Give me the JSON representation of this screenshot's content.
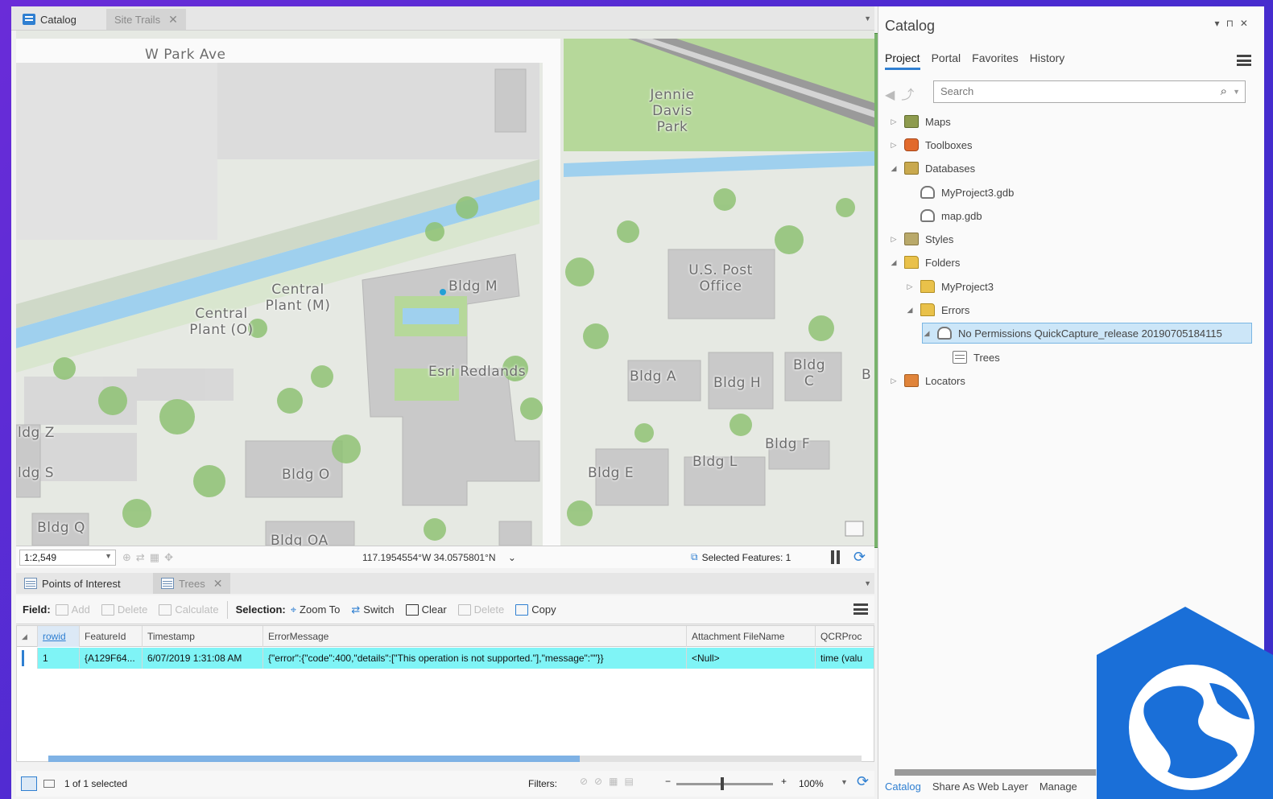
{
  "map_tabs": [
    {
      "label": "Catalog",
      "icon": "catalog-icon",
      "active": true
    },
    {
      "label": "Site Trails",
      "icon": "map-icon",
      "active": false
    }
  ],
  "map": {
    "labels": {
      "street": "W Park Ave",
      "park": "Jennie Davis Park",
      "post_office": "U.S. Post Office",
      "central_m": "Central Plant (M)",
      "central_o": "Central Plant (O)",
      "bldg_m": "Bldg M",
      "esri": "Esri Redlands",
      "bldg_a": "Bldg A",
      "bldg_h": "Bldg H",
      "bldg_c": "Bldg C",
      "bldg_b": "B",
      "bldg_z": "ldg Z",
      "bldg_s": "ldg S",
      "bldg_o": "Bldg O",
      "bldg_e": "Bldg E",
      "bldg_l": "Bldg L",
      "bldg_f": "Bldg F",
      "bldg_q": "Bldg Q",
      "bldg_oa": "Bldg OA"
    },
    "colors": {
      "land": "#e9ece6",
      "green": "#b6d89a",
      "tree": "#8fc274",
      "water": "#9fd0ee",
      "building": "#c9c9c9",
      "road": "#fafafa"
    }
  },
  "map_status": {
    "scale": "1:2,549",
    "coordinates": "117.1954554°W 34.0575801°N",
    "selected_features": "Selected Features: 1"
  },
  "table_tabs": [
    {
      "label": "Points of Interest",
      "active": true
    },
    {
      "label": "Trees",
      "active": false
    }
  ],
  "toolbar": {
    "field_label": "Field:",
    "add": "Add",
    "delete": "Delete",
    "calculate": "Calculate",
    "selection_label": "Selection:",
    "zoom_to": "Zoom To",
    "switch": "Switch",
    "clear": "Clear",
    "sel_delete": "Delete",
    "copy": "Copy"
  },
  "table": {
    "columns": [
      "rowid",
      "FeatureId",
      "Timestamp",
      "ErrorMessage",
      "Attachment FileName",
      "QCRProc"
    ],
    "rows": [
      [
        "1",
        "{A129F64...",
        "6/07/2019 1:31:08 AM",
        "{\"error\":{\"code\":400,\"details\":[\"This operation is not supported.\"],\"message\":\"\"}}",
        "<Null>",
        "time (valu"
      ]
    ]
  },
  "table_status": {
    "selected": "1 of 1 selected",
    "filters": "Filters:",
    "zoom": "100%"
  },
  "catalog": {
    "title": "Catalog",
    "tabs": [
      "Project",
      "Portal",
      "Favorites",
      "History"
    ],
    "search_placeholder": "Search",
    "tree": {
      "maps": "Maps",
      "toolboxes": "Toolboxes",
      "databases": "Databases",
      "myproject_gdb": "MyProject3.gdb",
      "map_gdb": "map.gdb",
      "styles": "Styles",
      "folders": "Folders",
      "myproject_folder": "MyProject3",
      "errors": "Errors",
      "no_permissions": "No Permissions QuickCapture_release 20190705184115",
      "trees": "Trees",
      "locators": "Locators"
    },
    "bottom_tabs": [
      "Catalog",
      "Share As Web Layer",
      "Manage"
    ]
  }
}
